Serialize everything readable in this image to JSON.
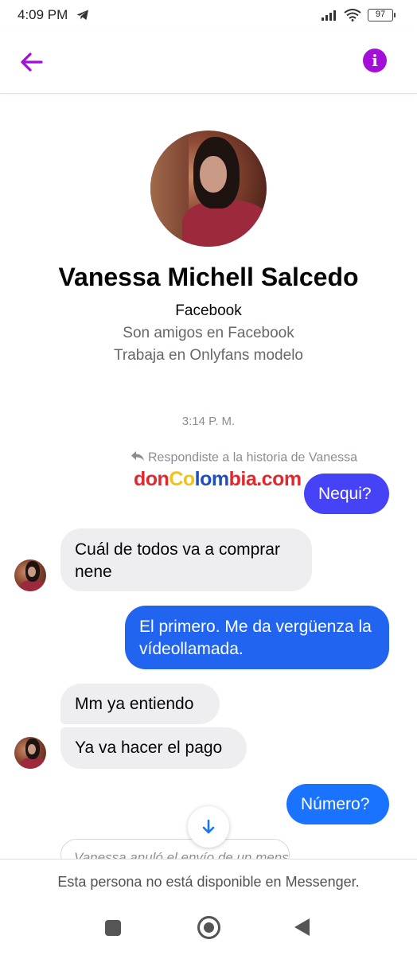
{
  "status_bar": {
    "time": "4:09 PM",
    "battery": "97",
    "icons": [
      "telegram-icon",
      "signal-icon",
      "wifi-icon",
      "battery-icon"
    ]
  },
  "header": {
    "back_icon": "arrow-left-icon",
    "info_icon": "info-icon",
    "info_glyph": "i",
    "accent_color": "#a30ed8"
  },
  "profile": {
    "name": "Vanessa Michell Salcedo",
    "source": "Facebook",
    "friends": "Son amigos en Facebook",
    "work": "Trabaja en Onlyfans modelo"
  },
  "conversation": {
    "timestamp": "3:14 P. M.",
    "reply_note": "Respondiste a la historia de Vanessa",
    "watermark": {
      "part1": "don",
      "part2": "Co",
      "part3": "lom",
      "part4": "bia.com"
    },
    "messages": [
      {
        "sender": "me",
        "text": "Nequi?"
      },
      {
        "sender": "them",
        "text": "Cuál de todos va a comprar nene"
      },
      {
        "sender": "me",
        "text": "El primero. Me da vergüenza la vídeollamada."
      },
      {
        "sender": "them",
        "text": "Mm ya entiendo"
      },
      {
        "sender": "them",
        "text": "Ya va hacer el pago"
      },
      {
        "sender": "me",
        "text": "Número?"
      }
    ],
    "unsent_note": "Vanessa anuló el envío de un mensaje"
  },
  "footer": {
    "text": "Esta persona no está disponible en Messenger."
  },
  "colors": {
    "bubble_blue_1": "#4642f6",
    "bubble_blue_2": "#2164f0",
    "bubble_blue_3": "#1a73ff",
    "bubble_gray": "#eeeef0"
  }
}
